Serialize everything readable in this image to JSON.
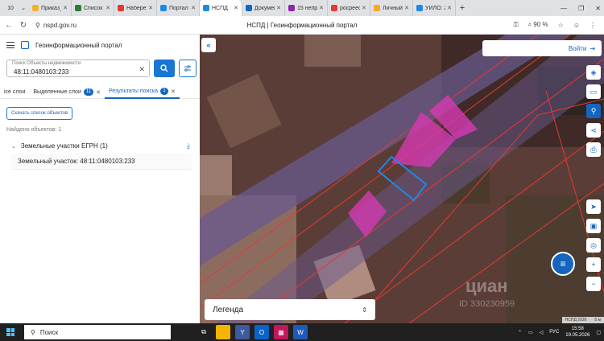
{
  "browser": {
    "tab_count": "10",
    "tabs": [
      {
        "title": "Приказ_о",
        "fav_color": "#f2b134"
      },
      {
        "title": "Список з",
        "fav_color": "#2e7d32"
      },
      {
        "title": "Набережн",
        "fav_color": "#e53935"
      },
      {
        "title": "Портал п",
        "fav_color": "#1e88e5"
      },
      {
        "title": "НСПД",
        "fav_color": "#1e88e5",
        "active": true
      },
      {
        "title": "Документ",
        "fav_color": "#1565c0"
      },
      {
        "title": "15 непрон",
        "fav_color": "#8e24aa"
      },
      {
        "title": "росреест",
        "fav_color": "#e53935"
      },
      {
        "title": "Личный к",
        "fav_color": "#f9a825"
      },
      {
        "title": "УИЛО: 20",
        "fav_color": "#1e88e5"
      }
    ],
    "new_tab": "+",
    "url": "nspd.gov.ru",
    "page_title": "НСПД | Геоинформационный портал",
    "zoom": "90 %"
  },
  "portal": {
    "title": "Геоинформационный портал",
    "search": {
      "placeholder": "Поиск Объекты недвижимости",
      "value": "48:11:0480103:233"
    },
    "tabs": [
      {
        "label": "ісе слои",
        "badge": ""
      },
      {
        "label": "Выделенные слои",
        "badge": "11"
      },
      {
        "label": "Результаты поиска",
        "badge": "1",
        "active": true
      }
    ],
    "download_label": "Скачать список объектов",
    "found_label": "Найдено объектов: 1",
    "group_label": "Земельные участки ЕГРН (1)",
    "result_label": "Земельный участок: 48:11:0480103:233"
  },
  "map": {
    "login_label": "Войти",
    "legend_label": "Легенда",
    "watermark": "циан",
    "watermark_id": "ID 330230959",
    "attribution": "НСПД 2026",
    "scale_label": "5 м"
  },
  "taskbar": {
    "search_label": "Поиск",
    "lang": "РУС",
    "time": "15:58",
    "date": "19.05.2026"
  }
}
